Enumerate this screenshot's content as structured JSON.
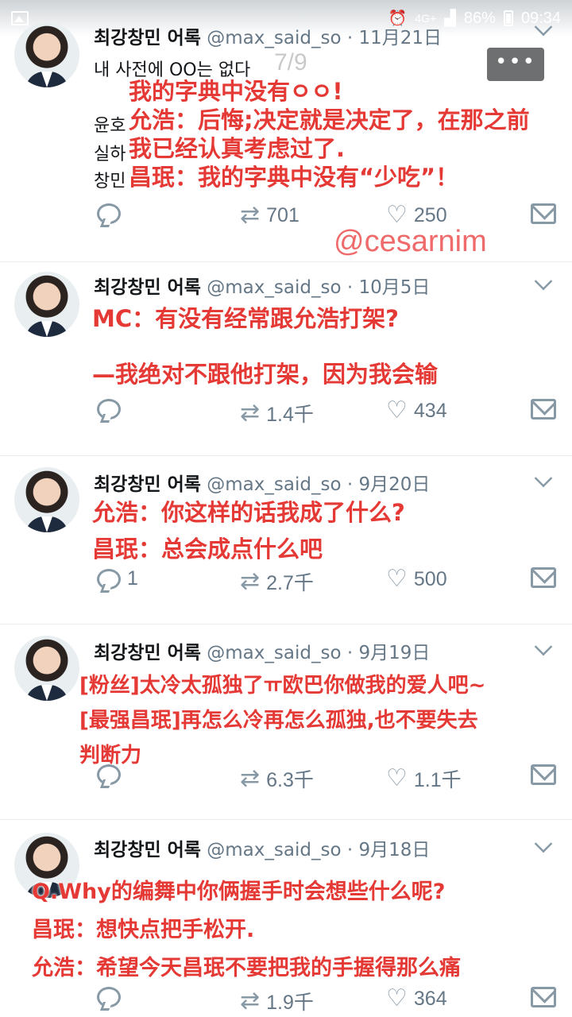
{
  "status_bar": {
    "network": "4G+",
    "battery": "86%",
    "time": "09:34"
  },
  "page_indicator": "7/9",
  "more_label": "•••",
  "watermark": "@cesarnim",
  "tweets": [
    {
      "name": "최강창민 어록",
      "handle": "@max_said_so · 11月21日",
      "original_lines": [
        "내 사전에 OO는 없다",
        "윤호",
        "실하",
        "창민"
      ],
      "overlay_lines": [
        "我的字典中没有ㅇㅇ!",
        "允浩：后悔;决定就是决定了，在那之前",
        "我已经认真考虑过了.",
        "昌珉：我的字典中没有“少吃”！"
      ],
      "replies": "",
      "retweets": "701",
      "likes": "250"
    },
    {
      "name": "최강창민 어록",
      "handle": "@max_said_so · 10月5日",
      "original_lines": [],
      "overlay_lines": [
        "MC：有没有经常跟允浩打架?",
        "—我绝对不跟他打架，因为我会输"
      ],
      "replies": "",
      "retweets": "1.4千",
      "likes": "434"
    },
    {
      "name": "최강창민 어록",
      "handle": "@max_said_so · 9月20日",
      "original_lines": [],
      "overlay_lines": [
        "允浩：你这样的话我成了什么?",
        "昌珉：总会成点什么吧"
      ],
      "replies": "1",
      "retweets": "2.7千",
      "likes": "500"
    },
    {
      "name": "최강창민 어록",
      "handle": "@max_said_so · 9月19日",
      "original_lines": [],
      "overlay_lines": [
        "[粉丝]太冷太孤独了ㅠ欧巴你做我的爱人吧~",
        "[最强昌珉]再怎么冷再怎么孤独,也不要失去",
        "判断力"
      ],
      "replies": "",
      "retweets": "6.3千",
      "likes": "1.1千"
    },
    {
      "name": "최강창민 어록",
      "handle": "@max_said_so · 9月18日",
      "original_lines": [],
      "overlay_lines": [
        "Q.Why的编舞中你俩握手时会想些什么呢?",
        "昌珉：想快点把手松开.",
        "允浩：希望今天昌珉不要把我的手握得那么痛"
      ],
      "replies": "",
      "retweets": "1.9千",
      "likes": "364"
    }
  ]
}
